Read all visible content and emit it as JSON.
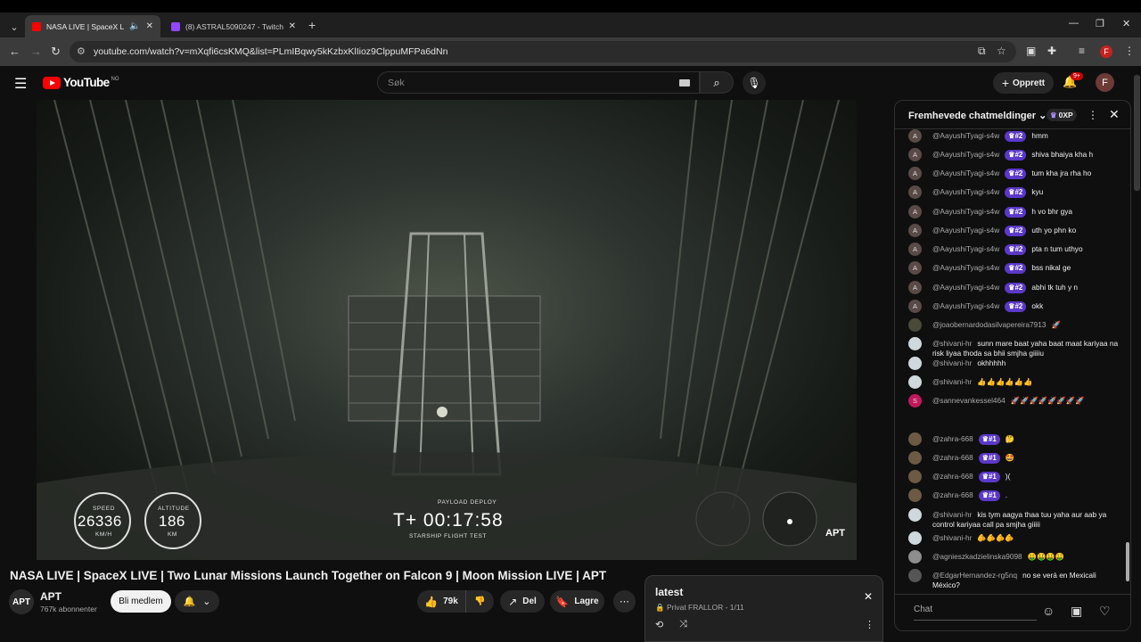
{
  "browser": {
    "tabs": [
      {
        "title": "NASA LIVE | SpaceX LIVE | Tw",
        "active": true,
        "favicon_color": "#ff0000"
      },
      {
        "title": "(8) ASTRAL5090247 - Twitch",
        "active": false,
        "favicon_color": "#9146ff"
      }
    ],
    "url": "youtube.com/watch?v=mXqfi6csKMQ&list=PLmIBqwy5kKzbxKlIioz9ClppuMFPa6dNn",
    "profile_initial": "F"
  },
  "youtube": {
    "logo_text": "YouTube",
    "country_code": "NO",
    "search_placeholder": "Søk",
    "create_label": "Opprett",
    "notification_count": "9+",
    "avatar_initial": "F"
  },
  "video": {
    "speed_label": "SPEED",
    "speed_value": "26336",
    "speed_unit": "KM/H",
    "altitude_label": "ALTITUDE",
    "altitude_value": "186",
    "altitude_unit": "KM",
    "event_label": "PAYLOAD DEPLOY",
    "timer": "T+ 00:17:58",
    "flight_label": "STARSHIP FLIGHT TEST",
    "watermark": "APT",
    "title": "NASA LIVE | SpaceX LIVE | Two Lunar Missions Launch Together on Falcon 9 | Moon Mission LIVE | APT"
  },
  "channel": {
    "avatar_text": "APT",
    "name": "APT",
    "subscribers": "767k abonnenter",
    "join_label": "Bli medlem"
  },
  "actions": {
    "likes": "79k",
    "share_label": "Del",
    "save_label": "Lagre"
  },
  "playlist": {
    "title": "latest",
    "subtitle": "Privat FRALLOR - 1/11"
  },
  "chat": {
    "header": "Fremhevede chatmeldinger",
    "xp": "0XP",
    "input_placeholder": "Chat",
    "messages": [
      {
        "author": "@AayushiTyagi-s4w",
        "badge": "#2",
        "text": "hmm",
        "avatar": "A",
        "avatar_color": "#5a4a47"
      },
      {
        "author": "@AayushiTyagi-s4w",
        "badge": "#2",
        "text": "shiva bhaiya kha h",
        "avatar": "A",
        "avatar_color": "#5a4a47"
      },
      {
        "author": "@AayushiTyagi-s4w",
        "badge": "#2",
        "text": "tum kha jra rha ho",
        "avatar": "A",
        "avatar_color": "#5a4a47"
      },
      {
        "author": "@AayushiTyagi-s4w",
        "badge": "#2",
        "text": "kyu",
        "avatar": "A",
        "avatar_color": "#5a4a47"
      },
      {
        "author": "@AayushiTyagi-s4w",
        "badge": "#2",
        "text": "h vo bhr gya",
        "avatar": "A",
        "avatar_color": "#5a4a47"
      },
      {
        "author": "@AayushiTyagi-s4w",
        "badge": "#2",
        "text": "uth yo phn ko",
        "avatar": "A",
        "avatar_color": "#5a4a47"
      },
      {
        "author": "@AayushiTyagi-s4w",
        "badge": "#2",
        "text": "pta n tum uthyo",
        "avatar": "A",
        "avatar_color": "#5a4a47"
      },
      {
        "author": "@AayushiTyagi-s4w",
        "badge": "#2",
        "text": "bss nikal ge",
        "avatar": "A",
        "avatar_color": "#5a4a47"
      },
      {
        "author": "@AayushiTyagi-s4w",
        "badge": "#2",
        "text": "abhi tk tuh y n",
        "avatar": "A",
        "avatar_color": "#5a4a47"
      },
      {
        "author": "@AayushiTyagi-s4w",
        "badge": "#2",
        "text": "okk",
        "avatar": "A",
        "avatar_color": "#5a4a47"
      },
      {
        "author": "@joaobernardodasilvapereira7913",
        "badge": "",
        "text": "🚀",
        "avatar": "",
        "avatar_color": "#4a4a3a"
      },
      {
        "author": "@shivani-hr",
        "badge": "",
        "text": "sunn mare baat yaha baat maat kariyaa na risk liyaa thoda sa bhii smjha giiiiu",
        "avatar": "",
        "avatar_color": "#cfd8dc"
      },
      {
        "author": "@shivani-hr",
        "badge": "",
        "text": "okhhhhh",
        "avatar": "",
        "avatar_color": "#cfd8dc"
      },
      {
        "author": "@shivani-hr",
        "badge": "",
        "text": "👍👍👍👍👍👍",
        "avatar": "",
        "avatar_color": "#cfd8dc"
      },
      {
        "author": "@sannevankessel464",
        "badge": "",
        "text": "🚀🚀🚀🚀🚀🚀🚀🚀",
        "avatar": "S",
        "avatar_color": "#c2185b"
      },
      {
        "author": "@zahra-668",
        "badge": "#1",
        "text": "🤔",
        "avatar": "",
        "avatar_color": "#6d5a44"
      },
      {
        "author": "@zahra-668",
        "badge": "#1",
        "text": "🤩",
        "avatar": "",
        "avatar_color": "#6d5a44"
      },
      {
        "author": "@zahra-668",
        "badge": "#1",
        "text": ")(",
        "avatar": "",
        "avatar_color": "#6d5a44"
      },
      {
        "author": "@zahra-668",
        "badge": "#1",
        "text": ".",
        "avatar": "",
        "avatar_color": "#6d5a44"
      },
      {
        "author": "@shivani-hr",
        "badge": "",
        "text": "kis tym aagya thaa tuu yaha aur aab ya control kariyaa call pa smjha giiiii",
        "avatar": "",
        "avatar_color": "#cfd8dc"
      },
      {
        "author": "@shivani-hr",
        "badge": "",
        "text": "🫵🫵🫵🫵",
        "avatar": "",
        "avatar_color": "#cfd8dc"
      },
      {
        "author": "@agnieszkadzielinska9098",
        "badge": "",
        "text": "🤑🤑🤑🤑",
        "avatar": "",
        "avatar_color": "#8d8d8d"
      },
      {
        "author": "@EdgarHernandez-rg5nq",
        "badge": "",
        "text": "no se verá en Mexicali México?",
        "avatar": "",
        "avatar_color": "#555"
      }
    ]
  }
}
